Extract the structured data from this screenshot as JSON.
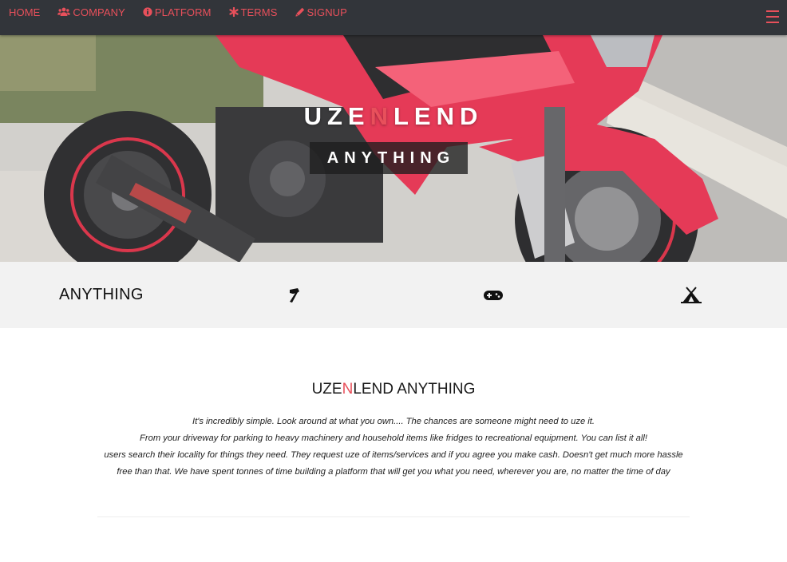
{
  "nav": {
    "items": [
      {
        "label": "HOME",
        "icon": ""
      },
      {
        "label": "COMPANY",
        "icon": "users-icon"
      },
      {
        "label": "PLATFORM",
        "icon": "info-circle-icon"
      },
      {
        "label": "TERMS",
        "icon": "asterisk-icon"
      },
      {
        "label": "SIGNUP",
        "icon": "pencil-icon"
      }
    ],
    "menu_icon": "hamburger-menu-icon"
  },
  "hero": {
    "title_part1": "UZE",
    "title_accent": "N",
    "title_part2": "LEND",
    "badge": "ANYTHING"
  },
  "categories": {
    "label": "ANYTHING",
    "icons": [
      "hammer-icon",
      "gamepad-icon",
      "tent-icon"
    ]
  },
  "content": {
    "title_part1": "UZE",
    "title_accent": "N",
    "title_part2": "LEND ANYTHING",
    "lines": [
      "It's incredibly simple. Look around at what you own.... The chances are someone might need to uze it.",
      "From your driveway for parking to heavy machinery and household items like fridges to recreational equipment. You can list it all!",
      "users search their locality for things they need. They request uze of items/services and if you agree you make cash. Doesn't get much more hassle",
      "free than that. We have spent tonnes of time building a platform that will get you what you need, wherever you are, no matter the time of day"
    ]
  },
  "colors": {
    "accent": "#e8505b",
    "nav_bg": "#32353a",
    "category_bg": "#f2f2f2"
  }
}
